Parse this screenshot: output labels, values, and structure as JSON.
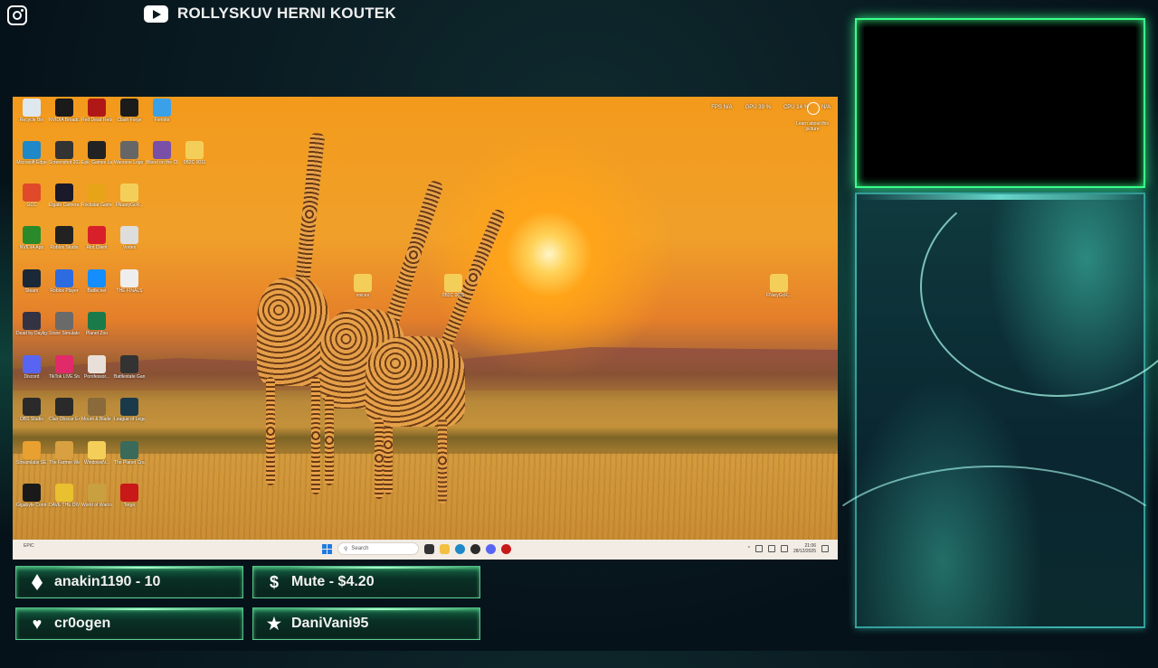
{
  "header": {
    "channel_name": "ROLLYSKUV HERNI KOUTEK",
    "social_icons": [
      "instagram-icon",
      "youtube-icon"
    ]
  },
  "desktop": {
    "icons": [
      {
        "label": "Recycle Bin",
        "color": "#dfe8ef"
      },
      {
        "label": "NVIDIA Broadcast",
        "color": "#1a1a1a"
      },
      {
        "label": "Red Dead Redemptio...",
        "color": "#b01818"
      },
      {
        "label": "Clash Forge",
        "color": "#1b1b1b"
      },
      {
        "label": "Fortnite",
        "color": "#3aa0e8"
      },
      {
        "label": "Microsoft Edge",
        "color": "#1e88c8"
      },
      {
        "label": "Screenshot 2025-07...",
        "color": "#333333"
      },
      {
        "label": "Epic Games Launcher",
        "color": "#222222"
      },
      {
        "label": "Warzone Logo Conv...",
        "color": "#666666"
      },
      {
        "label": "Blood on the Clocktower",
        "color": "#7a4fa8"
      },
      {
        "label": "0B2C 0011",
        "color": "#f3cf5a"
      },
      {
        "label": "GCC",
        "color": "#e04a2a"
      },
      {
        "label": "Elgato Camera Hub",
        "color": "#1a1a2a"
      },
      {
        "label": "Rockstar Games ...",
        "color": "#e8a418"
      },
      {
        "label": "FNaaryGcR...",
        "color": "#f3cf5a"
      },
      {
        "label": "NVIDIA App",
        "color": "#2a8a2a"
      },
      {
        "label": "Roblox Studio",
        "color": "#222222"
      },
      {
        "label": "Riot Client",
        "color": "#d8202a"
      },
      {
        "label": "Vortex",
        "color": "#dddddd"
      },
      {
        "label": "Steam",
        "color": "#1b2838"
      },
      {
        "label": "Roblox Player",
        "color": "#2c6be0"
      },
      {
        "label": "Battle.net",
        "color": "#148eff"
      },
      {
        "label": "THE FINALS",
        "color": "#eeeeee"
      },
      {
        "label": "Dead by Daylight",
        "color": "#333344"
      },
      {
        "label": "Stone Simulator",
        "color": "#6a6a6a"
      },
      {
        "label": "Planet Zoo",
        "color": "#1a7a4a"
      },
      {
        "label": "Discord",
        "color": "#5865f2"
      },
      {
        "label": "TikTok LIVE Studio",
        "color": "#e02a6a"
      },
      {
        "label": "Porofessor...",
        "color": "#e8e0d8"
      },
      {
        "label": "Battlestate Games L...",
        "color": "#333333"
      },
      {
        "label": "OBS Studio",
        "color": "#2a2a2a"
      },
      {
        "label": "Clair Obscur Expedition 33",
        "color": "#2a2a2a"
      },
      {
        "label": "Mount & Blade II B...",
        "color": "#8a6a3a"
      },
      {
        "label": "League of Legends",
        "color": "#1a3a4a"
      },
      {
        "label": "Streamlabs SE.Live",
        "color": "#e8a030"
      },
      {
        "label": "The Farmer Was Repl...",
        "color": "#d8a040"
      },
      {
        "label": "WindowsN...",
        "color": "#f3cf5a"
      },
      {
        "label": "The Planet Crafter",
        "color": "#3a6a5a"
      },
      {
        "label": "Gigabyte Control",
        "color": "#1a1a1a"
      },
      {
        "label": "DAVE THE DIVER",
        "color": "#e8c030"
      },
      {
        "label": "World of Warcraft",
        "color": "#c8a040"
      },
      {
        "label": "Tergo",
        "color": "#c81818"
      }
    ],
    "folders": [
      {
        "label": "voices"
      },
      {
        "label": "0B2C 0011"
      },
      {
        "label": "FNaryGcR..."
      }
    ],
    "perf": {
      "fps": "FPS N/A",
      "gpu": "GPU 39 %",
      "cpu": "CPU 14 %",
      "extra": "N/A"
    },
    "learn_label": "Learn about this picture",
    "taskbar": {
      "left_label": "EPIC",
      "search_placeholder": "Search",
      "time": "21:06",
      "date": "28/12/2025"
    }
  },
  "alerts": {
    "latest_follower": "anakin1190 - 10",
    "latest_donation": "Mute - $4.20",
    "latest_sub": "cr0ogen",
    "top_star": "DaniVani95"
  },
  "colors": {
    "neon_green": "#3cff8a",
    "teal": "#50e6dc",
    "windows_blue": "#1f7be0"
  }
}
